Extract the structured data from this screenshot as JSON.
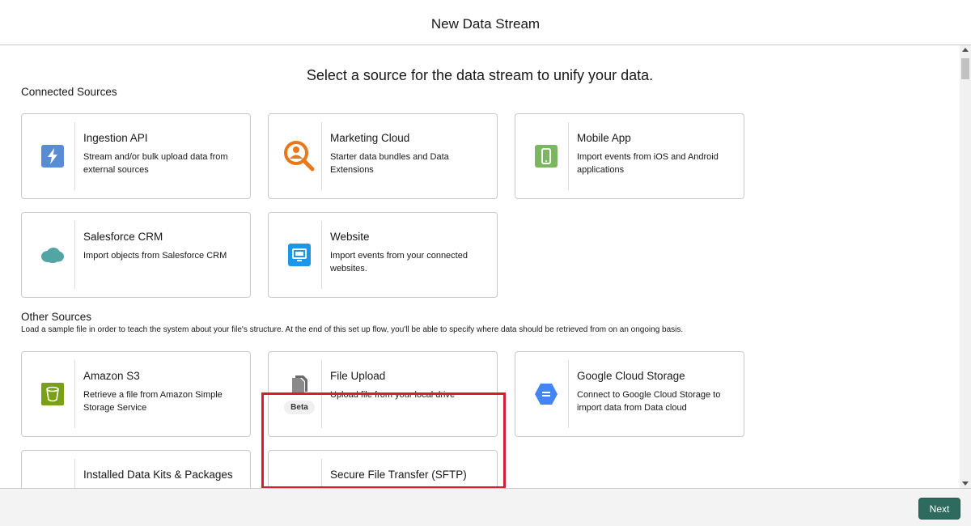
{
  "header": {
    "title": "New Data Stream"
  },
  "main": {
    "subtitle": "Select a source for the data stream to unify your data.",
    "connected_sources": {
      "label": "Connected Sources",
      "cards": [
        {
          "name": "Ingestion API",
          "desc": "Stream and/or bulk upload data from external sources",
          "icon": "lightning-icon",
          "color": "#5a8bd6"
        },
        {
          "name": "Marketing Cloud",
          "desc": "Starter data bundles and Data Extensions",
          "icon": "magnifier-person-icon",
          "color": "#e8781e"
        },
        {
          "name": "Mobile App",
          "desc": "Import events from iOS and Android applications",
          "icon": "mobile-icon",
          "color": "#7cb660"
        },
        {
          "name": "Salesforce CRM",
          "desc": "Import objects from Salesforce CRM",
          "icon": "salesforce-cloud-icon",
          "color": "#52a5a3"
        },
        {
          "name": "Website",
          "desc": "Import events from your connected websites.",
          "icon": "monitor-icon",
          "color": "#1b96e8"
        }
      ]
    },
    "other_sources": {
      "label": "Other Sources",
      "description": "Load a sample file in order to teach the system about your file's structure. At the end of this set up flow, you'll be able to specify where data should be retrieved from on an ongoing basis.",
      "cards": [
        {
          "name": "Amazon S3",
          "desc": "Retrieve a file from Amazon Simple Storage Service",
          "icon": "bucket-icon",
          "color": "#7aa116"
        },
        {
          "name": "File Upload",
          "desc": "Upload file from your local drive",
          "icon": "document-icon",
          "color": "#6b6b6b",
          "badge": "Beta"
        },
        {
          "name": "Google Cloud Storage",
          "desc": "Connect to Google Cloud Storage to import data from Data cloud",
          "icon": "gcs-hexagon-icon",
          "color": "#4285f4"
        },
        {
          "name": "Installed Data Kits & Packages",
          "desc": "",
          "icon": "package-icon",
          "color": "#444444"
        },
        {
          "name": "Secure File Transfer (SFTP)",
          "desc": "",
          "icon": "folder-icon",
          "color": "#0e8a7e"
        }
      ]
    }
  },
  "footer": {
    "next_label": "Next",
    "accent": "#2e6b5e"
  },
  "highlight_color": "#d2202f"
}
